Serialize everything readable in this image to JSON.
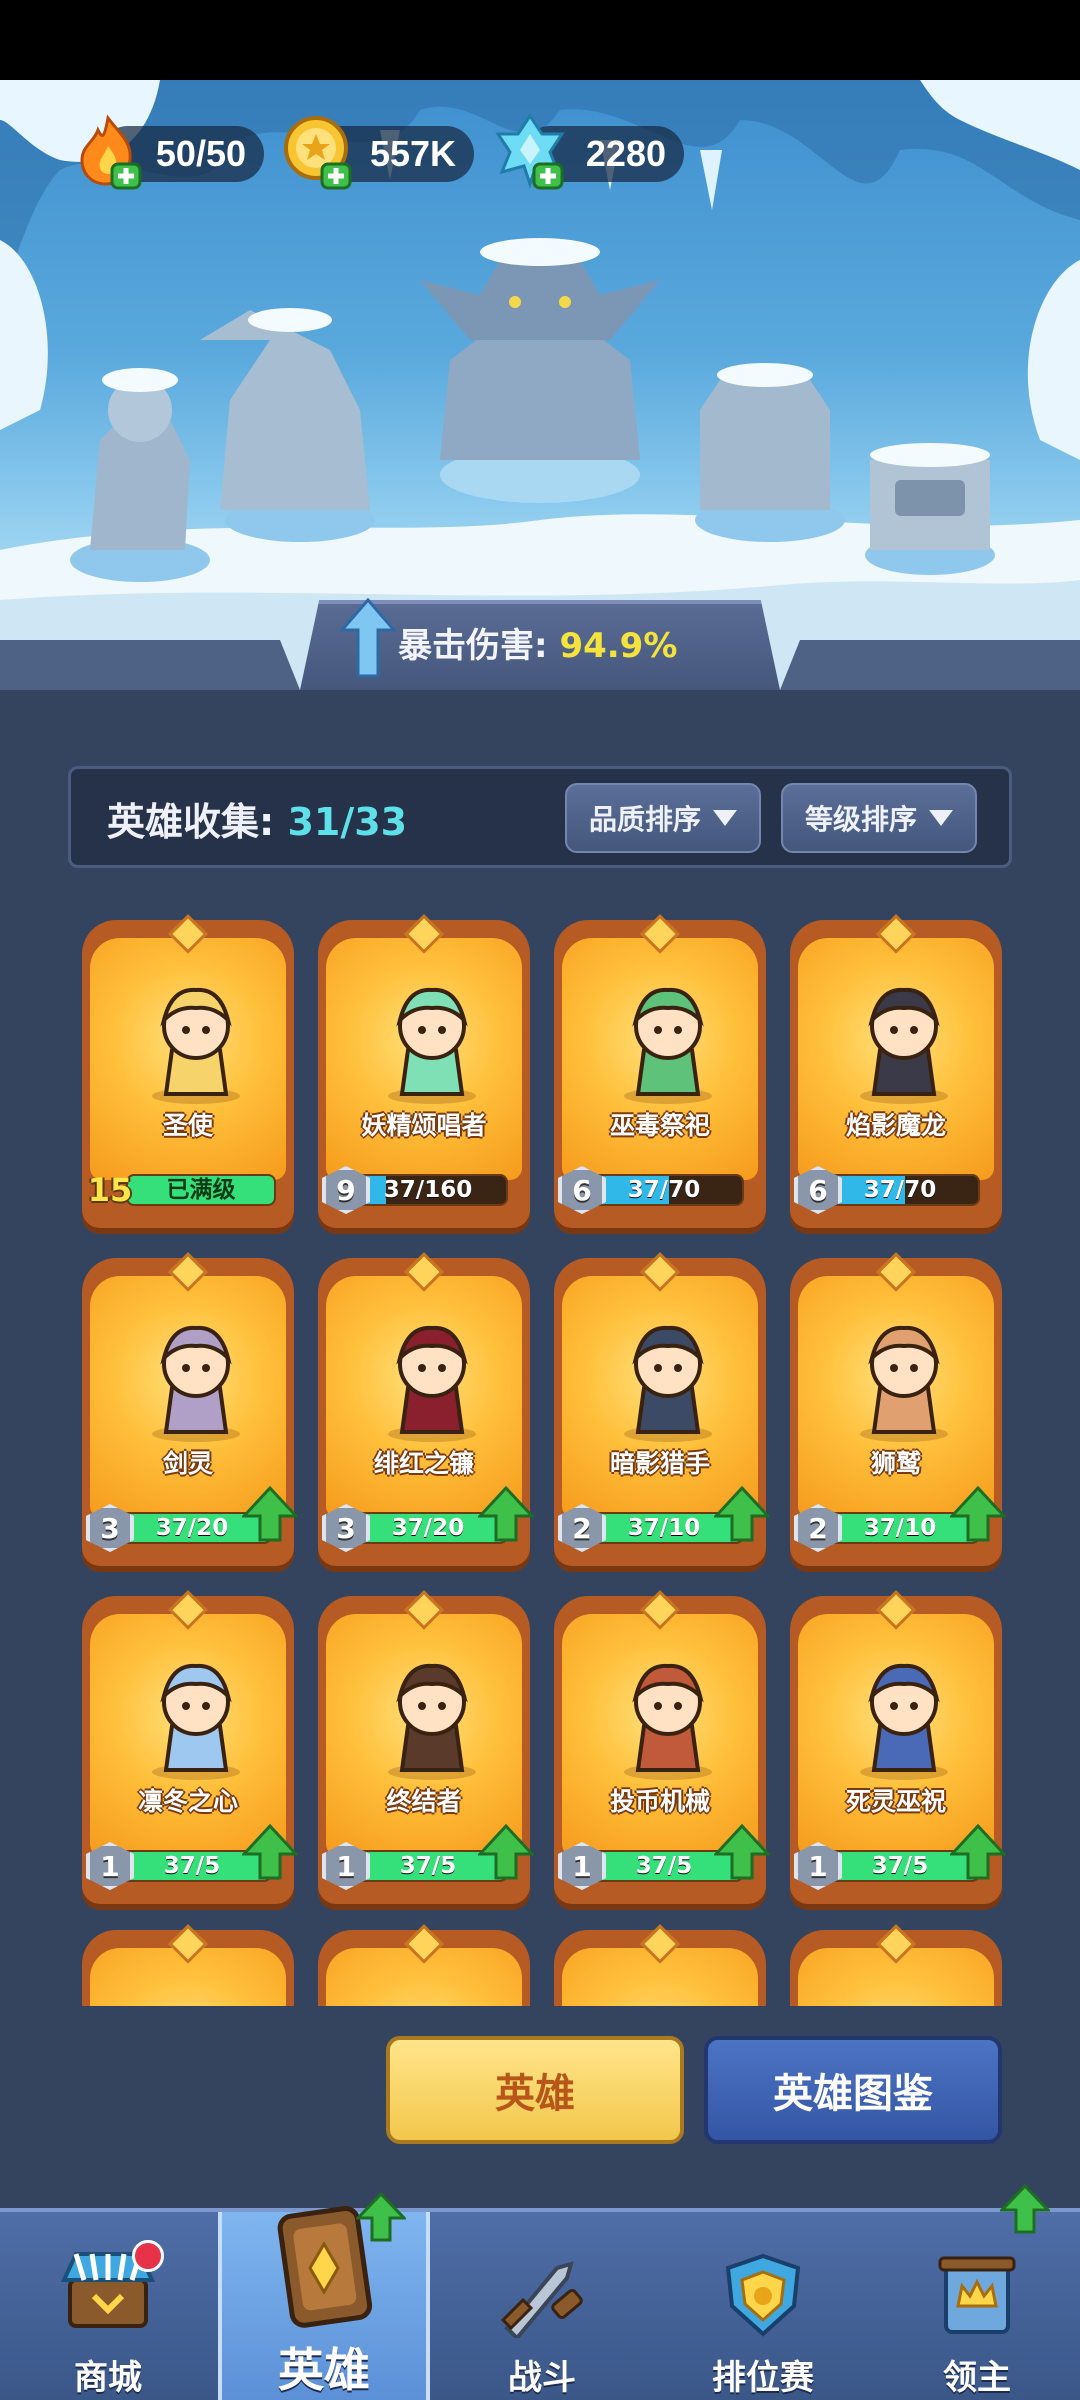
{
  "resources": {
    "energy": "50/50",
    "gold": "557K",
    "gems": "2280"
  },
  "crit": {
    "label": "暴击伤害:",
    "value": "94.9%"
  },
  "collection": {
    "label": "英雄收集:",
    "count": "31/33",
    "sort_quality": "品质排序",
    "sort_level": "等级排序"
  },
  "heroes": [
    {
      "name": "圣使",
      "level": "15",
      "progress": "已满级",
      "fill": 1.0,
      "fill_color": "#35e07a",
      "upgrade": false,
      "max": true
    },
    {
      "name": "妖精颂唱者",
      "level": "9",
      "progress": "37/160",
      "fill": 0.23,
      "fill_color": "#2fb8e8",
      "upgrade": false,
      "max": false
    },
    {
      "name": "巫毒祭祀",
      "level": "6",
      "progress": "37/70",
      "fill": 0.53,
      "fill_color": "#2fb8e8",
      "upgrade": false,
      "max": false
    },
    {
      "name": "焰影魔龙",
      "level": "6",
      "progress": "37/70",
      "fill": 0.53,
      "fill_color": "#2fb8e8",
      "upgrade": false,
      "max": false
    },
    {
      "name": "剑灵",
      "level": "3",
      "progress": "37/20",
      "fill": 1.0,
      "fill_color": "#35e07a",
      "upgrade": true,
      "max": false
    },
    {
      "name": "绯红之镰",
      "level": "3",
      "progress": "37/20",
      "fill": 1.0,
      "fill_color": "#35e07a",
      "upgrade": true,
      "max": false
    },
    {
      "name": "暗影猎手",
      "level": "2",
      "progress": "37/10",
      "fill": 1.0,
      "fill_color": "#35e07a",
      "upgrade": true,
      "max": false
    },
    {
      "name": "狮鹫",
      "level": "2",
      "progress": "37/10",
      "fill": 1.0,
      "fill_color": "#35e07a",
      "upgrade": true,
      "max": false
    },
    {
      "name": "凛冬之心",
      "level": "1",
      "progress": "37/5",
      "fill": 1.0,
      "fill_color": "#35e07a",
      "upgrade": true,
      "max": false
    },
    {
      "name": "终结者",
      "level": "1",
      "progress": "37/5",
      "fill": 1.0,
      "fill_color": "#35e07a",
      "upgrade": true,
      "max": false
    },
    {
      "name": "投币机械",
      "level": "1",
      "progress": "37/5",
      "fill": 1.0,
      "fill_color": "#35e07a",
      "upgrade": true,
      "max": false
    },
    {
      "name": "死灵巫祝",
      "level": "1",
      "progress": "37/5",
      "fill": 1.0,
      "fill_color": "#35e07a",
      "upgrade": true,
      "max": false
    }
  ],
  "tabs": {
    "hero": "英雄",
    "atlas": "英雄图鉴"
  },
  "nav": [
    {
      "label": "商城",
      "icon": "shop-icon"
    },
    {
      "label": "英雄",
      "icon": "hero-card-icon"
    },
    {
      "label": "战斗",
      "icon": "battle-icon"
    },
    {
      "label": "排位赛",
      "icon": "ranked-icon"
    },
    {
      "label": "领主",
      "icon": "lord-icon"
    }
  ],
  "colors": {
    "card_orange": "#f5a623",
    "progress_green": "#35e07a",
    "progress_blue": "#2fb8e8",
    "accent_yellow": "#f5e33d",
    "accent_cyan": "#5ee0e8"
  }
}
